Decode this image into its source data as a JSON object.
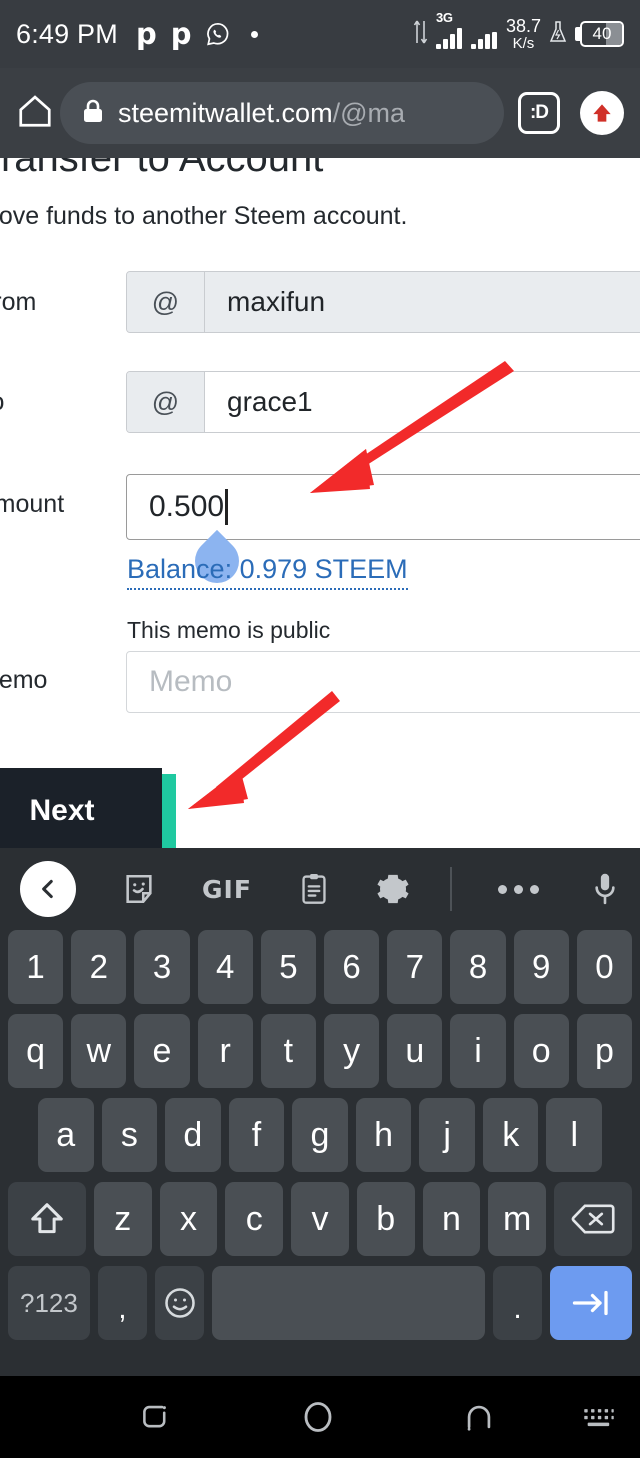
{
  "status_bar": {
    "time": "6:49 PM",
    "app_icons": [
      "p-app-icon",
      "p-app-icon",
      "whatsapp-icon",
      "dot-icon"
    ],
    "network_type": "3G",
    "data_speed_value": "38.7",
    "data_speed_unit": "K/s",
    "battery_percent": "40",
    "icons": [
      "sync-arrows-icon",
      "signal-bars-icon",
      "signal-bars-icon",
      "flask-icon",
      "battery-icon"
    ]
  },
  "browser_bar": {
    "home_icon": "home-icon",
    "lock_icon": "lock-icon",
    "url_main": "steemitwallet.com",
    "url_path": "/@ma",
    "smiley_label": ":D",
    "upload_icon": "up-arrow-icon"
  },
  "page": {
    "title": "Transfer to Account",
    "subtitle": "Move funds to another Steem account.",
    "fields": {
      "from": {
        "label": "From",
        "prefix": "@",
        "value": "maxifun"
      },
      "to": {
        "label": "To",
        "prefix": "@",
        "value": "grace1"
      },
      "amount": {
        "label": "Amount",
        "value": "0.500"
      },
      "memo": {
        "label": "Memo",
        "placeholder": "Memo",
        "note": "This memo is public"
      }
    },
    "balance_link": "Balance: 0.979 STEEM",
    "next_button": "Next",
    "colors": {
      "next_button_bg": "#1b2129",
      "accent_teal": "#1fc9a0",
      "link_blue": "#2b6cb8",
      "annotation_red": "#f22a2a",
      "cursor_handle_blue": "#8cb4f0"
    }
  },
  "keyboard": {
    "toolbar": [
      {
        "name": "back-chevron-icon",
        "label": ""
      },
      {
        "name": "sticker-icon",
        "label": ""
      },
      {
        "name": "gif-icon",
        "label": "GIF"
      },
      {
        "name": "clipboard-icon",
        "label": ""
      },
      {
        "name": "gear-icon",
        "label": ""
      },
      {
        "name": "overflow-dots-icon",
        "label": ""
      },
      {
        "name": "microphone-icon",
        "label": ""
      }
    ],
    "rows": {
      "numbers": [
        "1",
        "2",
        "3",
        "4",
        "5",
        "6",
        "7",
        "8",
        "9",
        "0"
      ],
      "top": [
        "q",
        "w",
        "e",
        "r",
        "t",
        "y",
        "u",
        "i",
        "o",
        "p"
      ],
      "home": [
        "a",
        "s",
        "d",
        "f",
        "g",
        "h",
        "j",
        "k",
        "l"
      ],
      "bottom": [
        "z",
        "x",
        "c",
        "v",
        "b",
        "n",
        "m"
      ]
    },
    "shift_key": "shift-icon",
    "backspace_key": "backspace-icon",
    "symbols_key": "?123",
    "comma_key": ",",
    "emoji_key": "emoji-icon",
    "space_key": "",
    "period_key": ".",
    "enter_key": "tab-next-icon"
  },
  "nav_bar": {
    "recents": "recents-icon",
    "home": "home-circle-icon",
    "back": "back-arch-icon",
    "hide_keyboard": "keyboard-dismiss-icon"
  }
}
